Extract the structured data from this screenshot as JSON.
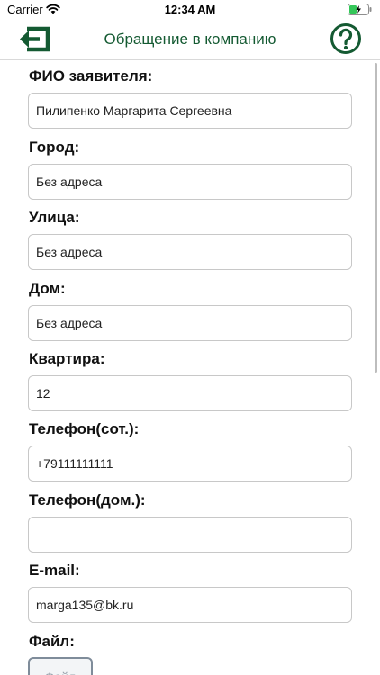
{
  "status_bar": {
    "carrier": "Carrier",
    "time": "12:34 AM"
  },
  "nav": {
    "title": "Обращение в компанию",
    "back_icon": "back-arrow-icon",
    "help_icon": "help-circle-icon",
    "accent_color": "#145a32"
  },
  "form": {
    "fio": {
      "label": "ФИО заявителя:",
      "value": "Пилипенко Маргарита Сергеевна"
    },
    "city": {
      "label": "Город:",
      "value": "Без адреса"
    },
    "street": {
      "label": "Улица:",
      "value": "Без адреса"
    },
    "house": {
      "label": "Дом:",
      "value": "Без адреса"
    },
    "apartment": {
      "label": "Квартира:",
      "value": "12"
    },
    "mobile": {
      "label": "Телефон(сот.):",
      "value": "+79111111111"
    },
    "home_phone": {
      "label": "Телефон(дом.):",
      "value": ""
    },
    "email": {
      "label": "E-mail:",
      "value": "marga135@bk.ru"
    },
    "file": {
      "label": "Файл:",
      "button_label": "Файл"
    }
  }
}
